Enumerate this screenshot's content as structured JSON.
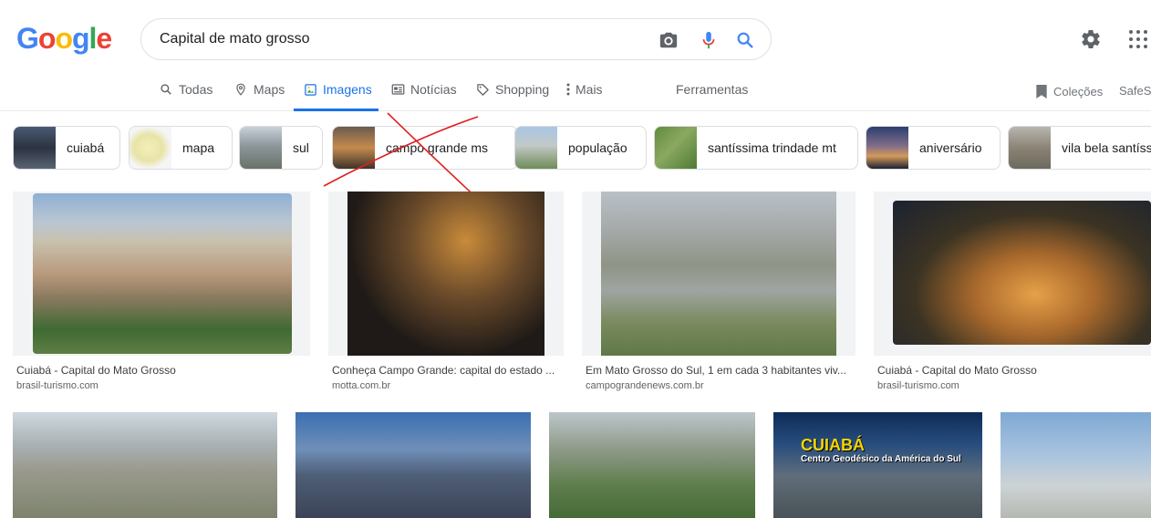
{
  "logo": {
    "letters": [
      "G",
      "o",
      "o",
      "g",
      "l",
      "e"
    ],
    "colors": [
      "#4285F4",
      "#EA4335",
      "#FBBC05",
      "#4285F4",
      "#34A853",
      "#EA4335"
    ]
  },
  "search": {
    "query": "Capital de mato grosso",
    "icons": [
      "camera-icon",
      "mic-icon",
      "search-icon"
    ]
  },
  "header_icons": [
    "settings-icon",
    "apps-icon"
  ],
  "nav": {
    "tabs": [
      {
        "label": "Todas",
        "icon": "search-icon"
      },
      {
        "label": "Maps",
        "icon": "map-pin-icon"
      },
      {
        "label": "Imagens",
        "icon": "image-icon",
        "active": true
      },
      {
        "label": "Notícias",
        "icon": "news-icon"
      },
      {
        "label": "Shopping",
        "icon": "tag-icon"
      },
      {
        "label": "Mais",
        "icon": "more-vert-icon"
      }
    ],
    "tools": "Ferramentas",
    "collections": "Coleções",
    "safesearch": "SafeSe"
  },
  "chips": [
    {
      "label": "cuiabá"
    },
    {
      "label": "mapa"
    },
    {
      "label": "sul"
    },
    {
      "label": "campo grande ms"
    },
    {
      "label": "população"
    },
    {
      "label": "santíssima trindade mt"
    },
    {
      "label": "aniversário"
    },
    {
      "label": "vila bela santíss"
    }
  ],
  "results": [
    {
      "title": "Cuiabá - Capital do Mato Grosso",
      "source": "brasil-turismo.com"
    },
    {
      "title": "Conheça Campo Grande: capital do estado ...",
      "source": "motta.com.br"
    },
    {
      "title": "Em Mato Grosso do Sul, 1 em cada 3 habitantes viv...",
      "source": "campograndenews.com.br"
    },
    {
      "title": "Cuiabá - Capital do Mato Grosso",
      "source": "brasil-turismo.com"
    }
  ],
  "second_row": [
    {
      "overlay_title": "",
      "overlay_subtitle": ""
    },
    {
      "overlay_title": "",
      "overlay_subtitle": ""
    },
    {
      "overlay_title": "",
      "overlay_subtitle": ""
    },
    {
      "overlay_title": "CUIABÁ",
      "overlay_subtitle": "Centro Geodésico da América do Sul"
    },
    {
      "overlay_title": "",
      "overlay_subtitle": ""
    }
  ],
  "colors": {
    "accent": "#1a73e8",
    "annotation_red": "#e02020"
  }
}
